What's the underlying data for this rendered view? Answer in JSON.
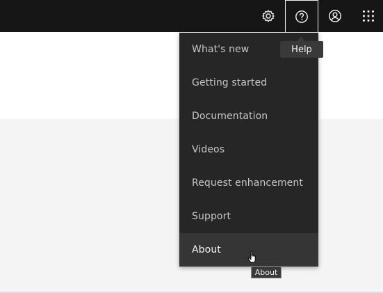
{
  "header": {
    "icons": [
      "gear-icon",
      "help-icon",
      "user-icon",
      "app-switcher-icon"
    ]
  },
  "help_menu": {
    "items": [
      {
        "label": "What's new"
      },
      {
        "label": "Getting started"
      },
      {
        "label": "Documentation"
      },
      {
        "label": "Videos"
      },
      {
        "label": "Request enhancement"
      },
      {
        "label": "Support"
      },
      {
        "label": "About"
      }
    ]
  },
  "tooltips": {
    "help": "Help",
    "about": "About"
  },
  "colors": {
    "header_bg": "#161616",
    "menu_bg": "#262626",
    "menu_hover_bg": "#353535",
    "menu_text": "#c6c6c6",
    "page_bg": "#f4f4f4"
  }
}
